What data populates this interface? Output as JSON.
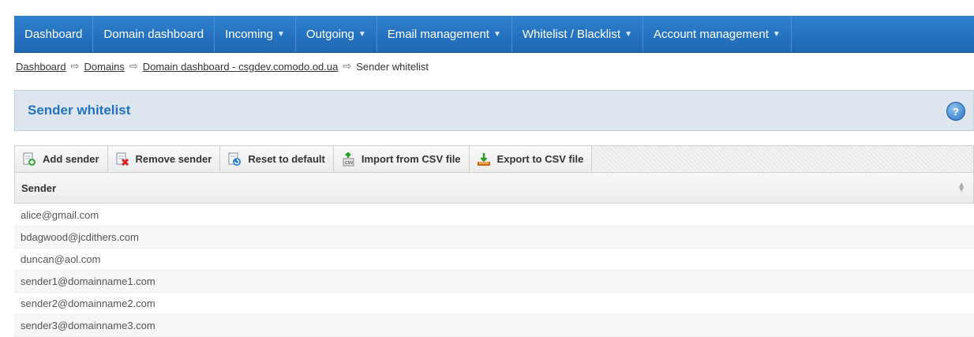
{
  "nav": {
    "items": [
      {
        "label": "Dashboard",
        "dropdown": false
      },
      {
        "label": "Domain dashboard",
        "dropdown": false
      },
      {
        "label": "Incoming",
        "dropdown": true
      },
      {
        "label": "Outgoing",
        "dropdown": true
      },
      {
        "label": "Email management",
        "dropdown": true
      },
      {
        "label": "Whitelist / Blacklist",
        "dropdown": true
      },
      {
        "label": "Account management",
        "dropdown": true
      }
    ]
  },
  "breadcrumb": {
    "items": [
      "Dashboard",
      "Domains",
      "Domain dashboard - csgdev.comodo.od.ua"
    ],
    "current": "Sender whitelist",
    "separator": "⇨"
  },
  "panel": {
    "title": "Sender whitelist",
    "help_icon": "?"
  },
  "toolbar": {
    "add": "Add sender",
    "remove": "Remove sender",
    "reset": "Reset to default",
    "import": "Import from CSV file",
    "export": "Export to CSV file"
  },
  "grid": {
    "column": "Sender",
    "rows": [
      "alice@gmail.com",
      "bdagwood@jcdithers.com",
      "duncan@aol.com",
      "sender1@domainname1.com",
      "sender2@domainname2.com",
      "sender3@domainname3.com"
    ]
  },
  "colors": {
    "nav_bg": "#2474c2",
    "title": "#2372bd",
    "panel_bg": "#dde6ee"
  }
}
